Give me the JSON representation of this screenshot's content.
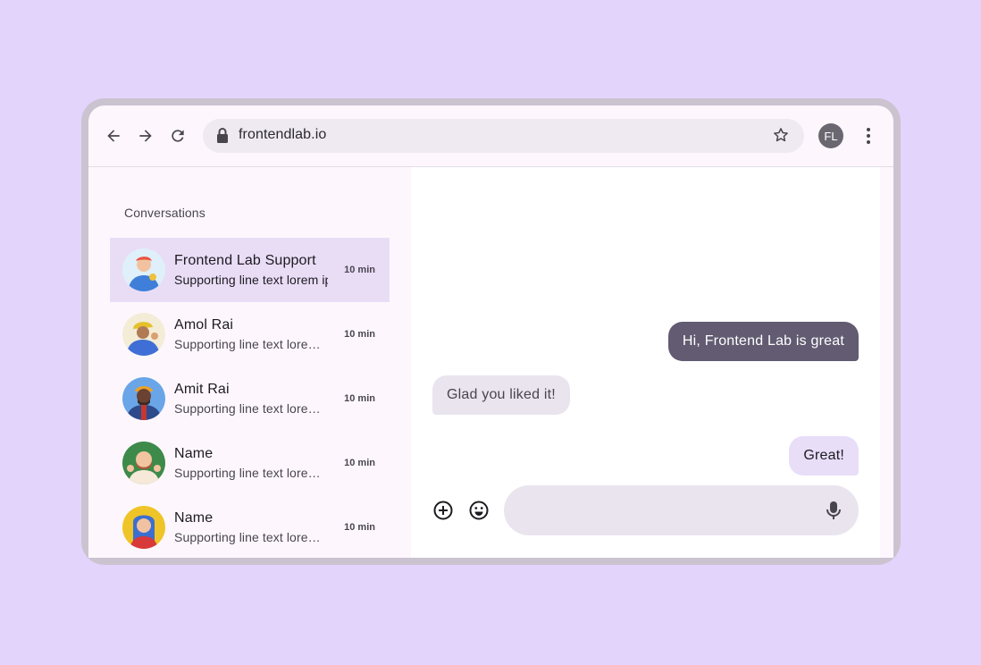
{
  "browser": {
    "url": "frontendlab.io",
    "profile_initials": "FL"
  },
  "sidebar": {
    "title": "Conversations",
    "items": [
      {
        "name": "Frontend Lab Support",
        "snippet": "Supporting line text lorem ipsum",
        "time": "10 min",
        "selected": true,
        "avatar_colors": [
          "#dff0fb",
          "#e9533e",
          "#3f7fd9"
        ]
      },
      {
        "name": "Amol Rai",
        "snippet": "Supporting line text lorem ipsum",
        "time": "10 min",
        "selected": false,
        "avatar_colors": [
          "#f3ecd7",
          "#e5c12b",
          "#3f6fd6"
        ]
      },
      {
        "name": "Amit Rai",
        "snippet": "Supporting line text lorem ipsum",
        "time": "10 min",
        "selected": false,
        "avatar_colors": [
          "#6aa5e8",
          "#e8a12a",
          "#3a2b24"
        ]
      },
      {
        "name": "Name",
        "snippet": "Supporting line text lorem ipsum",
        "time": "10 min",
        "selected": false,
        "avatar_colors": [
          "#3d8a4a",
          "#f2c4a0",
          "#b2563c"
        ]
      },
      {
        "name": "Name",
        "snippet": "Supporting line text lorem ipsum",
        "time": "10 min",
        "selected": false,
        "avatar_colors": [
          "#efc428",
          "#3c6fd0",
          "#f0c2a2"
        ]
      }
    ]
  },
  "chat": {
    "messages": [
      {
        "text": "Hi, Frontend Lab is great",
        "direction": "outgoing"
      },
      {
        "text": "Glad you liked it!",
        "direction": "incoming"
      },
      {
        "text": "Great!",
        "direction": "outgoing"
      }
    ],
    "composer_placeholder": ""
  },
  "colors": {
    "background": "#e3d4fc",
    "outgoing_bubble_dark": "#625b71",
    "incoming_bubble": "#e9e4ee",
    "outgoing_bubble_light": "#e8def8",
    "selected_row": "#e9ddf6"
  },
  "icons": [
    "back-arrow-icon",
    "forward-arrow-icon",
    "reload-icon",
    "lock-icon",
    "star-icon",
    "more-vert-icon",
    "add-circle-icon",
    "emoji-icon",
    "mic-icon"
  ]
}
